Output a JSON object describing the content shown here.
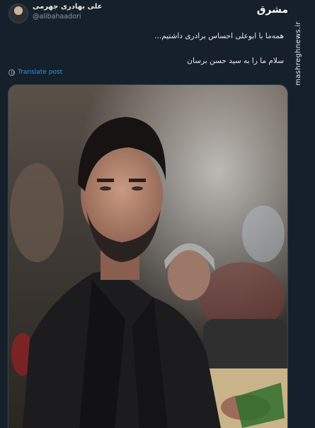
{
  "tweet": {
    "author_name": "علی بهادری جهرمی",
    "author_handle": "@alibahaadori",
    "text_line_1": "همه‌ما با ابوعلی احساس برادری داشتیم...",
    "text_line_2": "سلام ما را به سید حسن برسان",
    "translate_label": "Translate post"
  },
  "watermark": {
    "logo_text": "مشرق",
    "site_text": "mashreghnews.ir"
  },
  "icons": {
    "avatar": "user-avatar",
    "translate": "globe-icon",
    "logo": "mashregh-logo"
  },
  "colors": {
    "background": "#15202b",
    "text": "#e7e9ea",
    "muted": "#8b98a5",
    "link": "#1d9bf0"
  }
}
